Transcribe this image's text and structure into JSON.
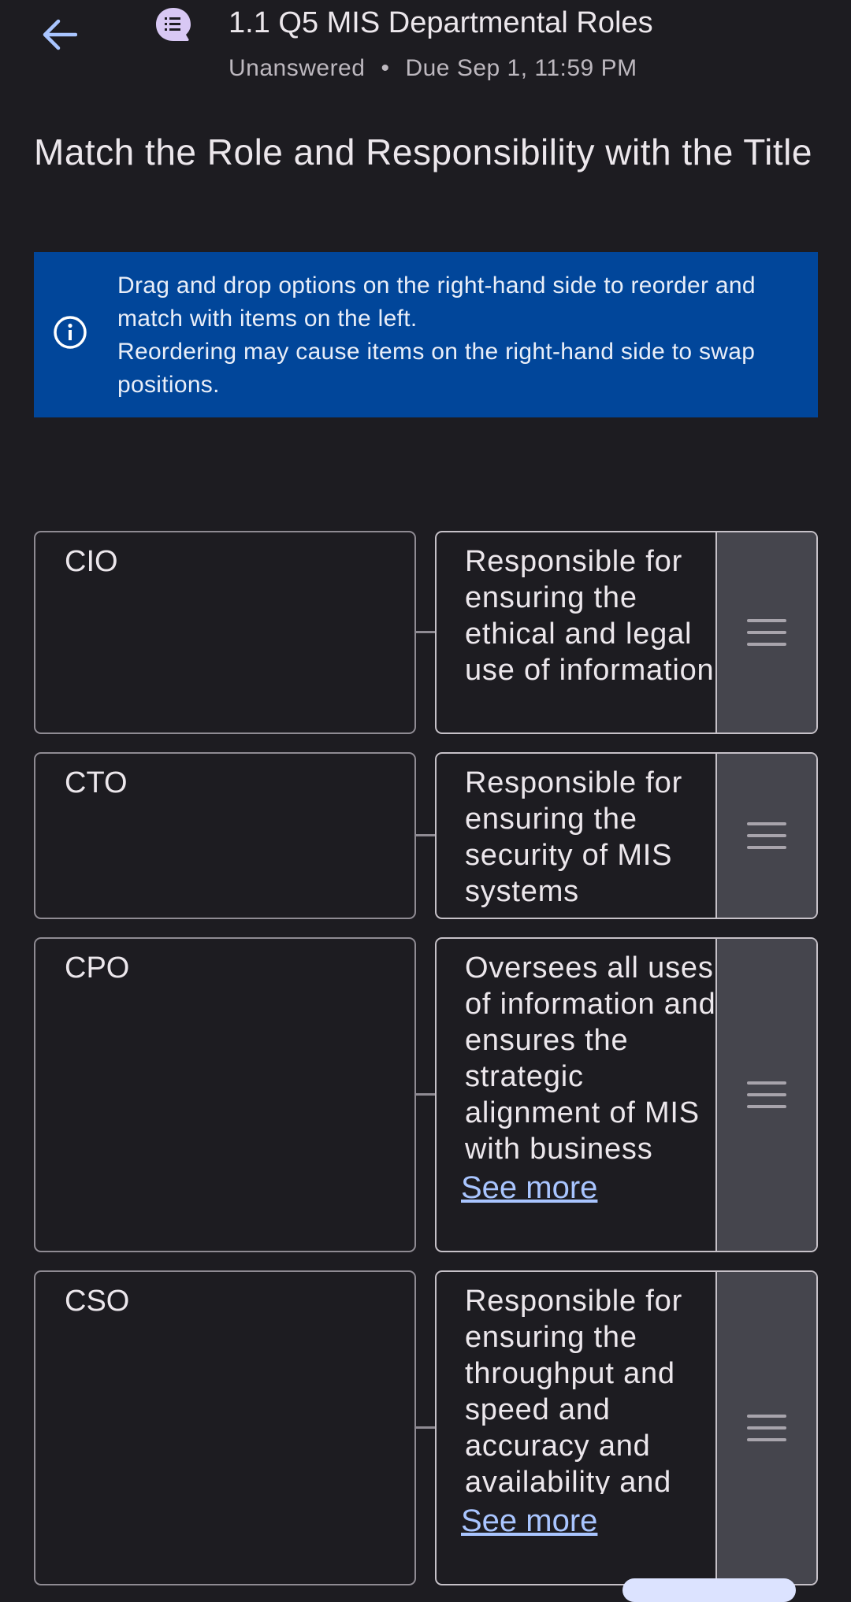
{
  "header": {
    "title": "1.1 Q5 MIS Departmental Roles",
    "status": "Unanswered",
    "separator": "•",
    "due": "Due Sep 1, 11:59 PM",
    "back_icon": "arrow-left-icon",
    "discussion_icon": "chat-list-icon"
  },
  "question": {
    "text": "Match the Role and Responsibility with the Title"
  },
  "info": {
    "icon": "info-icon",
    "line1": "Drag and drop options on the right-hand side to reorder and match with items on the left.",
    "line2": "Reordering may cause items on the right-hand side to swap positions."
  },
  "pairs": [
    {
      "title": "CIO",
      "description": "Responsible for ensuring the ethical and legal use of information",
      "see_more": ""
    },
    {
      "title": "CTO",
      "description": "Responsible for ensuring the security of MIS systems",
      "see_more": ""
    },
    {
      "title": "CPO",
      "description": "Oversees all uses of information and ensures the strategic alignment of MIS with business",
      "see_more": "See more"
    },
    {
      "title": "CSO",
      "description": "Responsible for ensuring the throughput and speed and accuracy and availability and",
      "see_more": "See more"
    }
  ],
  "colors": {
    "background": "#1d1c21",
    "info_banner": "#01469a",
    "link": "#a9c5ff",
    "handle": "#45454d"
  }
}
